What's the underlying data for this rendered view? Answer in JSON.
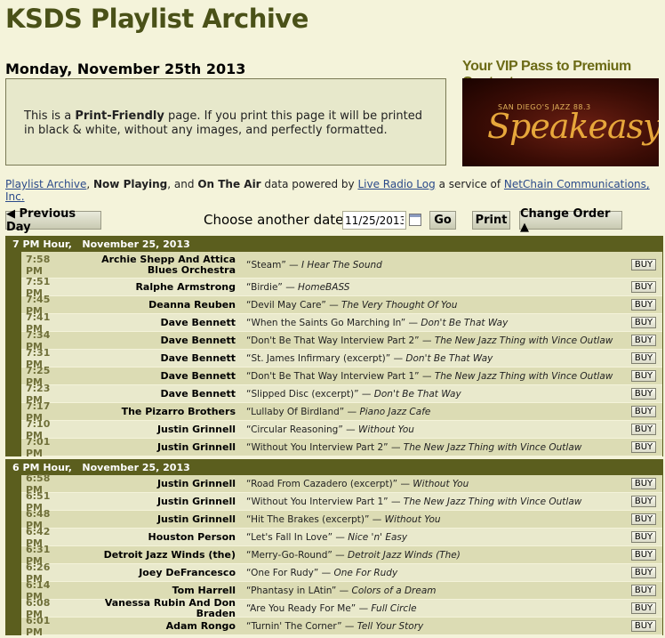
{
  "site": {
    "title": "KSDS Playlist Archive"
  },
  "date_heading": "Monday, November 25th 2013",
  "print_notice": {
    "prefix": "This is a ",
    "bold": "Print-Friendly",
    "suffix": " page. If you print this page it will be printed in black & white, without any images, and perfectly formatted."
  },
  "promo": {
    "title": "Your VIP Pass to Premium Content",
    "small": "SAN DIEGO'S JAZZ 88.3",
    "brand": "Speakeasy"
  },
  "credit": {
    "link1": "Playlist Archive",
    "sep1": ", ",
    "bold1": "Now Playing",
    "sep2": ", and ",
    "bold2": "On The Air",
    "mid": " data powered by ",
    "link2": "Live Radio Log",
    "mid2": " a service of ",
    "link3": "NetChain Communications, Inc."
  },
  "controls": {
    "prev_label": "◀ Previous Day",
    "choose_label": "Choose another date:",
    "date_value": "11/25/2013",
    "go_label": "Go",
    "print_label": "Print",
    "order_label": "Change Order ▲"
  },
  "hours": [
    {
      "title": "7 PM Hour,   November 25, 2013",
      "rows": [
        {
          "time": "7:58 PM",
          "artist": "Archie Shepp And Attica Blues Orchestra",
          "song": "“Steam”",
          "album": "I Hear The Sound",
          "buy": "BUY"
        },
        {
          "time": "7:51 PM",
          "artist": "Ralphe Armstrong",
          "song": "“Birdie”",
          "album": "HomeBASS",
          "buy": "BUY"
        },
        {
          "time": "7:45 PM",
          "artist": "Deanna Reuben",
          "song": "“Devil May Care”",
          "album": "The Very Thought Of You",
          "buy": "BUY"
        },
        {
          "time": "7:41 PM",
          "artist": "Dave Bennett",
          "song": "“When the Saints Go Marching In”",
          "album": "Don't Be That Way",
          "buy": "BUY"
        },
        {
          "time": "7:34 PM",
          "artist": "Dave Bennett",
          "song": "“Don't Be That Way Interview Part 2”",
          "album": "The New Jazz Thing with Vince Outlaw",
          "buy": "BUY"
        },
        {
          "time": "7:31 PM",
          "artist": "Dave Bennett",
          "song": "“St. James Infirmary (excerpt)”",
          "album": "Don't Be That Way",
          "buy": "BUY"
        },
        {
          "time": "7:25 PM",
          "artist": "Dave Bennett",
          "song": "“Don't Be That Way Interview Part 1”",
          "album": "The New Jazz Thing with Vince Outlaw",
          "buy": "BUY"
        },
        {
          "time": "7:23 PM",
          "artist": "Dave Bennett",
          "song": "“Slipped Disc (excerpt)”",
          "album": "Don't Be That Way",
          "buy": "BUY"
        },
        {
          "time": "7:17 PM",
          "artist": "The Pizarro Brothers",
          "song": "“Lullaby Of Birdland”",
          "album": "Piano Jazz Cafe",
          "buy": "BUY"
        },
        {
          "time": "7:10 PM",
          "artist": "Justin Grinnell",
          "song": "“Circular Reasoning”",
          "album": "Without You",
          "buy": "BUY"
        },
        {
          "time": "7:01 PM",
          "artist": "Justin Grinnell",
          "song": "“Without You Interview Part 2”",
          "album": "The New Jazz Thing with Vince Outlaw",
          "buy": "BUY"
        }
      ]
    },
    {
      "title": "6 PM Hour,   November 25, 2013",
      "rows": [
        {
          "time": "6:58 PM",
          "artist": "Justin Grinnell",
          "song": "“Road From Cazadero (excerpt)”",
          "album": "Without You",
          "buy": "BUY"
        },
        {
          "time": "6:51 PM",
          "artist": "Justin Grinnell",
          "song": "“Without You Interview Part 1”",
          "album": "The New Jazz Thing with Vince Outlaw",
          "buy": "BUY"
        },
        {
          "time": "6:48 PM",
          "artist": "Justin Grinnell",
          "song": "“Hit The Brakes (excerpt)”",
          "album": "Without You",
          "buy": "BUY"
        },
        {
          "time": "6:42 PM",
          "artist": "Houston Person",
          "song": "“Let's Fall In Love”",
          "album": "Nice 'n' Easy",
          "buy": "BUY"
        },
        {
          "time": "6:31 PM",
          "artist": "Detroit Jazz Winds (the)",
          "song": "“Merry-Go-Round”",
          "album": "Detroit Jazz Winds (The)",
          "buy": "BUY"
        },
        {
          "time": "6:26 PM",
          "artist": "Joey DeFrancesco",
          "song": "“One For Rudy”",
          "album": "One For Rudy",
          "buy": "BUY"
        },
        {
          "time": "6:14 PM",
          "artist": "Tom Harrell",
          "song": "“Phantasy in LAtin”",
          "album": "Colors of a Dream",
          "buy": "BUY"
        },
        {
          "time": "6:08 PM",
          "artist": "Vanessa Rubin And Don Braden",
          "song": "“Are You Ready For Me”",
          "album": "Full Circle",
          "buy": "BUY"
        },
        {
          "time": "6:01 PM",
          "artist": "Adam Rongo",
          "song": "“Turnin' The Corner”",
          "album": "Tell Your Story",
          "buy": "BUY"
        }
      ]
    }
  ]
}
